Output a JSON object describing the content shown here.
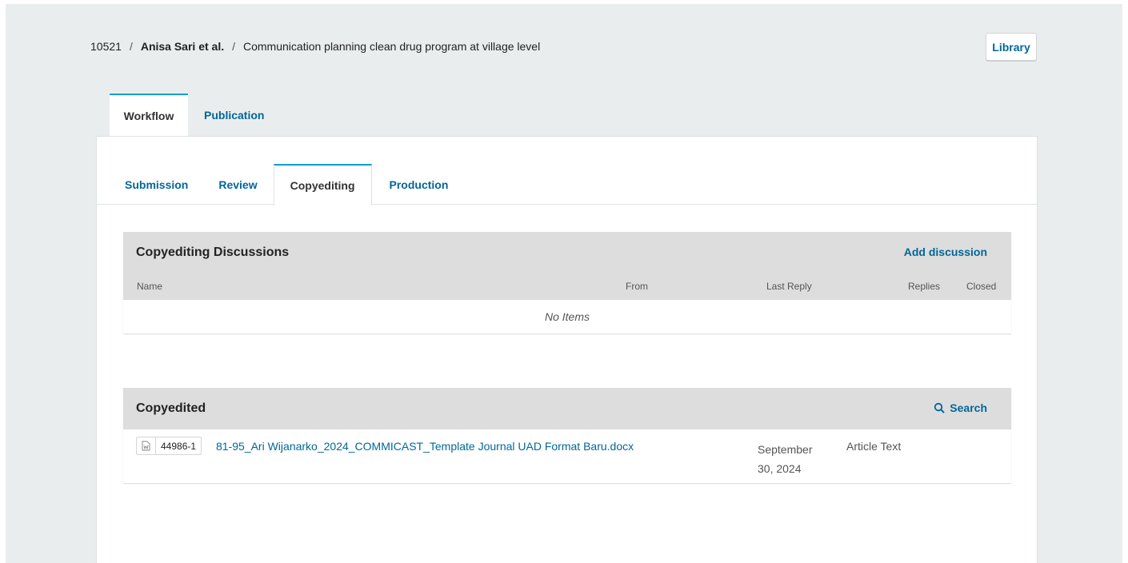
{
  "breadcrumb": {
    "id": "10521",
    "separator": "/",
    "author": "Anisa Sari et al.",
    "title": "Communication planning clean drug program at village level"
  },
  "header": {
    "library_label": "Library"
  },
  "main_tabs": [
    {
      "label": "Workflow"
    },
    {
      "label": "Publication"
    }
  ],
  "sub_tabs": [
    {
      "label": "Submission"
    },
    {
      "label": "Review"
    },
    {
      "label": "Copyediting"
    },
    {
      "label": "Production"
    }
  ],
  "discussions": {
    "title": "Copyediting Discussions",
    "action": "Add discussion",
    "columns": [
      "Name",
      "From",
      "Last Reply",
      "Replies",
      "Closed"
    ],
    "empty_text": "No Items"
  },
  "copyedited": {
    "title": "Copyedited",
    "action": "Search",
    "files": [
      {
        "id": "44986-1",
        "name": "81-95_Ari Wijanarko_2024_COMMICAST_Template Journal UAD Format Baru.docx",
        "date": "September 30, 2024",
        "type": "Article Text"
      }
    ]
  },
  "colors": {
    "accent": "#006798",
    "tab_highlight": "#009fd4",
    "background": "#eaedee"
  }
}
